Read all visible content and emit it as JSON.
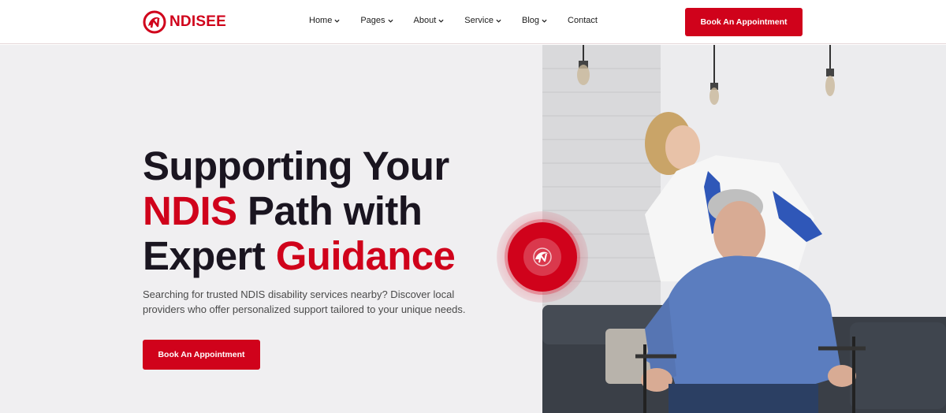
{
  "brand": {
    "name": "NDISEE",
    "accent": "#d0021b"
  },
  "nav": {
    "items": [
      {
        "label": "Home",
        "dropdown": true
      },
      {
        "label": "Pages",
        "dropdown": true
      },
      {
        "label": "About",
        "dropdown": true
      },
      {
        "label": "Service",
        "dropdown": true
      },
      {
        "label": "Blog",
        "dropdown": true
      },
      {
        "label": "Contact",
        "dropdown": false
      }
    ],
    "cta_label": "Book An Appointment"
  },
  "hero": {
    "title_line1": "Supporting Your",
    "title_red1": "NDIS",
    "title_line2_rest": " Path with",
    "title_line3_start": "Expert ",
    "title_red2": "Guidance",
    "description": "Searching for trusted NDIS disability services nearby? Discover local providers who offer personalized support tailored to your unique needs.",
    "cta_label": "Book An Appointment",
    "badge_icon": "logo-swirl-icon"
  },
  "photo": {
    "subject": "nurse-with-elderly-man-in-wheelchair-photo"
  }
}
